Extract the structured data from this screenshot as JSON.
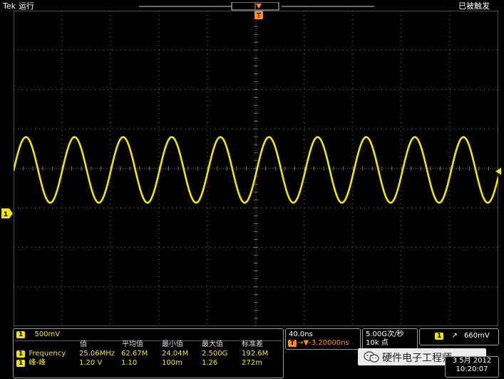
{
  "topbar": {
    "brand": "Tek",
    "run_state": "运行",
    "trigger_state": "已被触发"
  },
  "markers": {
    "trigger_pos": "T",
    "channel": "1"
  },
  "ch1_panel": {
    "chip": "1",
    "scale": "500mV"
  },
  "timebase": {
    "scale": "40.0ns",
    "trig_offset": "→▼-3.20000ns"
  },
  "acquisition": {
    "sample_rate": "5.00G次/秒",
    "record": "10k 点"
  },
  "trigger_panel": {
    "chip": "1",
    "slope": "↗",
    "level": "660mV"
  },
  "measurements": {
    "headers": [
      "值",
      "平均值",
      "最小值",
      "最大值",
      "标准差"
    ],
    "rows": [
      {
        "chip": "1",
        "name": "Frequency",
        "values": [
          "25.06MHz",
          "62.67M",
          "24.04M",
          "2.500G",
          "192.6M"
        ]
      },
      {
        "chip": "1",
        "name": "峰-峰",
        "values": [
          "1.20 V",
          "1.10",
          "100m",
          "1.26",
          "272m"
        ]
      }
    ]
  },
  "datetime": {
    "date": "3 5月 2012",
    "time": "10:20:07"
  },
  "watermark": {
    "text": "硬件电子工程师"
  },
  "colors": {
    "trace": "#f2e600",
    "trigger_marker": "#ff8c1a",
    "background": "#000000",
    "grid": "#6e6e6e"
  }
}
